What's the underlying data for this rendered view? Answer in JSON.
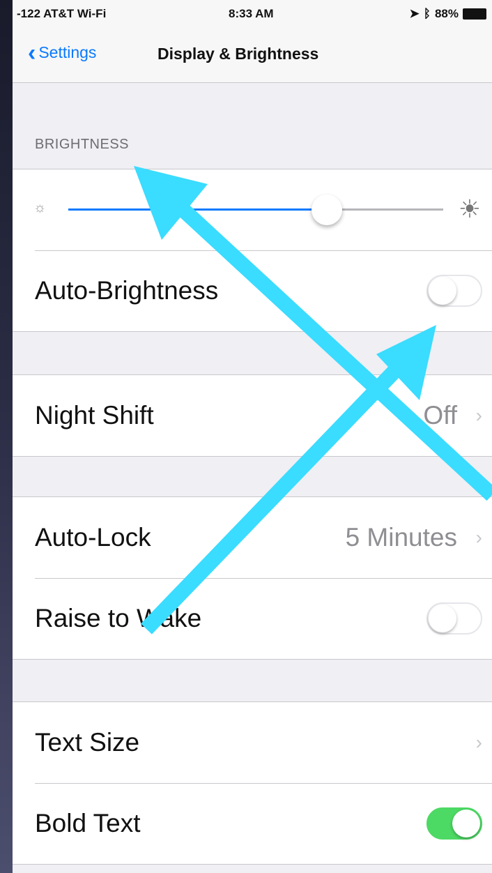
{
  "status_bar": {
    "carrier": "-122 AT&T Wi-Fi",
    "time": "8:33 AM",
    "battery": "88%"
  },
  "nav": {
    "back_label": "Settings",
    "title": "Display & Brightness"
  },
  "brightness": {
    "section_header": "BRIGHTNESS",
    "slider_level": 0.69,
    "auto_brightness": {
      "label": "Auto-Brightness",
      "on": false
    }
  },
  "night_shift": {
    "label": "Night Shift",
    "value": "Off"
  },
  "auto_lock": {
    "label": "Auto-Lock",
    "value": "5 Minutes"
  },
  "raise_to_wake": {
    "label": "Raise to Wake",
    "on": false
  },
  "text_size": {
    "label": "Text Size"
  },
  "bold_text": {
    "label": "Bold Text",
    "on": true
  },
  "colors": {
    "accent": "#0a7aff",
    "toggle_on": "#4cd964",
    "annotation_arrow": "#3adcff"
  },
  "icons": {
    "back": "chevron-left-icon",
    "brightness_min": "sun-small-icon",
    "brightness_max": "sun-large-icon",
    "disclosure": "chevron-right-icon"
  }
}
